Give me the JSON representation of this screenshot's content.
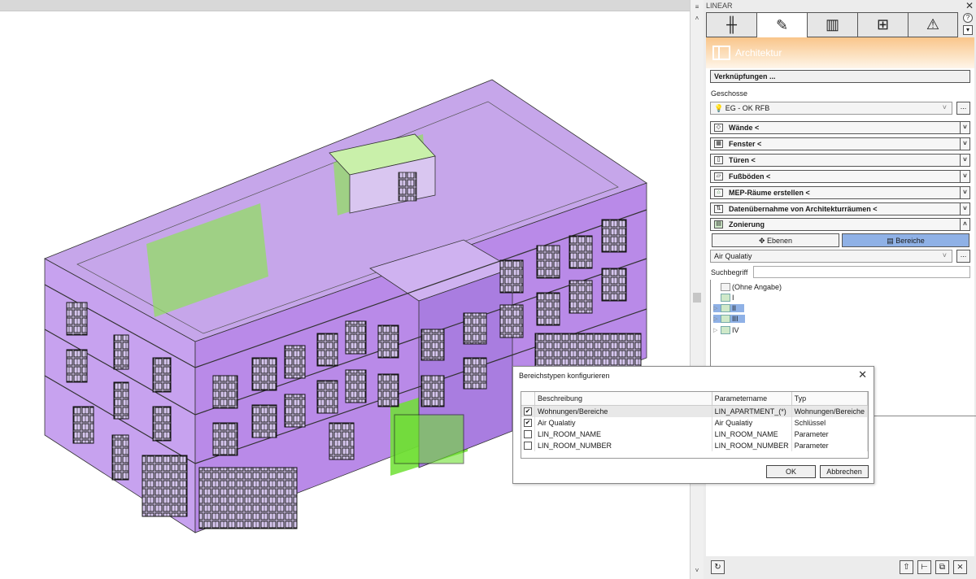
{
  "panel": {
    "title": "LINEAR",
    "close": "✕",
    "tabs": [
      {
        "icon": "sliders-icon"
      },
      {
        "icon": "pencil-icon"
      },
      {
        "icon": "library-icon"
      },
      {
        "icon": "grid-icon"
      },
      {
        "icon": "warning-icon"
      }
    ],
    "help": "?",
    "header": "Architektur",
    "links_button": "Verknüpfungen ...",
    "geschosse_label": "Geschosse",
    "geschosse_value": "EG - OK RFB",
    "dots": "...",
    "sections": [
      {
        "label": "Wände <",
        "icon": "wall-icon"
      },
      {
        "label": "Fenster <",
        "icon": "window-icon"
      },
      {
        "label": "Türen <",
        "icon": "door-icon"
      },
      {
        "label": "Fußböden <",
        "icon": "floor-icon"
      },
      {
        "label": "MEP-Räume erstellen <",
        "icon": "house-icon"
      },
      {
        "label": "Datenübernahme von Architekturräumen <",
        "icon": "transfer-icon"
      },
      {
        "label": "Zonierung",
        "icon": "zone-icon"
      }
    ],
    "ebenen_label": "Ebenen",
    "bereiche_label": "Bereiche",
    "zone_type": "Air Qualatiy",
    "suchbegriff_label": "Suchbegriff",
    "tree": [
      {
        "label": "(Ohne Angabe)",
        "expandable": false,
        "selected": false
      },
      {
        "label": "I",
        "expandable": false,
        "selected": false
      },
      {
        "label": "II",
        "expandable": true,
        "selected": true
      },
      {
        "label": "III",
        "expandable": true,
        "selected": true
      },
      {
        "label": "IV",
        "expandable": true,
        "selected": false
      }
    ]
  },
  "dialog": {
    "title": "Bereichstypen konfigurieren",
    "close": "✕",
    "columns": [
      "Beschreibung",
      "Parametername",
      "Typ"
    ],
    "rows": [
      {
        "checked": true,
        "beschreibung": "Wohnungen/Bereiche",
        "parametername": "LIN_APARTMENT_(*)",
        "typ": "Wohnungen/Bereiche"
      },
      {
        "checked": true,
        "beschreibung": "Air Qualatiy",
        "parametername": "Air Qualatiy",
        "typ": "Schlüssel"
      },
      {
        "checked": false,
        "beschreibung": "LIN_ROOM_NAME",
        "parametername": "LIN_ROOM_NAME",
        "typ": "Parameter"
      },
      {
        "checked": false,
        "beschreibung": "LIN_ROOM_NUMBER",
        "parametername": "LIN_ROOM_NUMBER",
        "typ": "Parameter"
      }
    ],
    "ok": "OK",
    "cancel": "Abbrechen"
  },
  "colors": {
    "zone_purple": "#9a5fe0",
    "zone_green": "#6fe033",
    "header_orange": "#f9c58a",
    "selection_blue": "#8fb1e6"
  }
}
